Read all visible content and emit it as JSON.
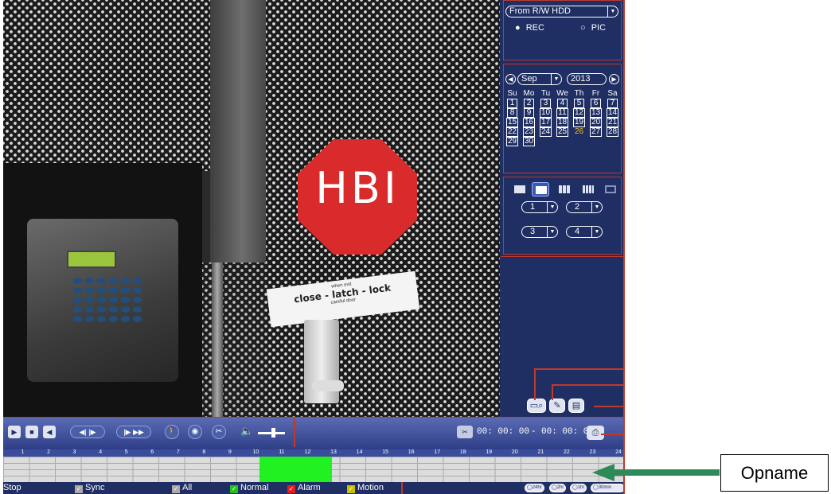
{
  "video": {
    "sign_text": "HBI",
    "label_line1": "when exit",
    "label_line2": "close - latch - lock",
    "label_line3": "careful door"
  },
  "source_panel": {
    "source_select": "From R/W HDD",
    "radio_rec": "REC",
    "radio_pic": "PIC",
    "selected": "REC"
  },
  "calendar": {
    "prev_icon": "chevron-left-icon",
    "next_icon": "chevron-right-icon",
    "month": "Sep",
    "year": "2013",
    "weekdays": [
      "Su",
      "Mo",
      "Tu",
      "We",
      "Th",
      "Fr",
      "Sa"
    ],
    "days": [
      "1",
      "2",
      "3",
      "4",
      "5",
      "6",
      "7",
      "8",
      "9",
      "10",
      "11",
      "12",
      "13",
      "14",
      "15",
      "16",
      "17",
      "18",
      "19",
      "20",
      "21",
      "22",
      "23",
      "24",
      "25",
      "26",
      "27",
      "28",
      "29",
      "30"
    ],
    "highlighted_day": "26"
  },
  "channels": {
    "layouts": [
      "1-window",
      "4-window",
      "9-window",
      "16-window",
      "fullscreen"
    ],
    "active_layout": "4-window",
    "selects": [
      "1",
      "2",
      "3",
      "4"
    ]
  },
  "toolbar": {
    "time_start": "00: 00: 00",
    "time_sep": "-",
    "time_end": "00: 00: 00"
  },
  "timeline": {
    "hours": [
      "1",
      "2",
      "3",
      "4",
      "5",
      "6",
      "7",
      "8",
      "9",
      "10",
      "11",
      "12",
      "13",
      "14",
      "15",
      "16",
      "17",
      "18",
      "19",
      "20",
      "21",
      "22",
      "23",
      "24"
    ],
    "recording_from_hour": 9.9,
    "recording_to_hour": 12.7
  },
  "legend": {
    "stop": "Stop",
    "sync": "Sync",
    "all": "All",
    "normal": "Normal",
    "alarm": "Alarm",
    "motion": "Motion",
    "zoom_24": "24hr",
    "zoom_2": "2hr",
    "zoom_1": "1hr",
    "zoom_30": "30min",
    "colors": {
      "normal": "#21f121",
      "alarm": "#e02020",
      "motion": "#e6d400"
    }
  },
  "annotation": {
    "label": "Opname"
  }
}
